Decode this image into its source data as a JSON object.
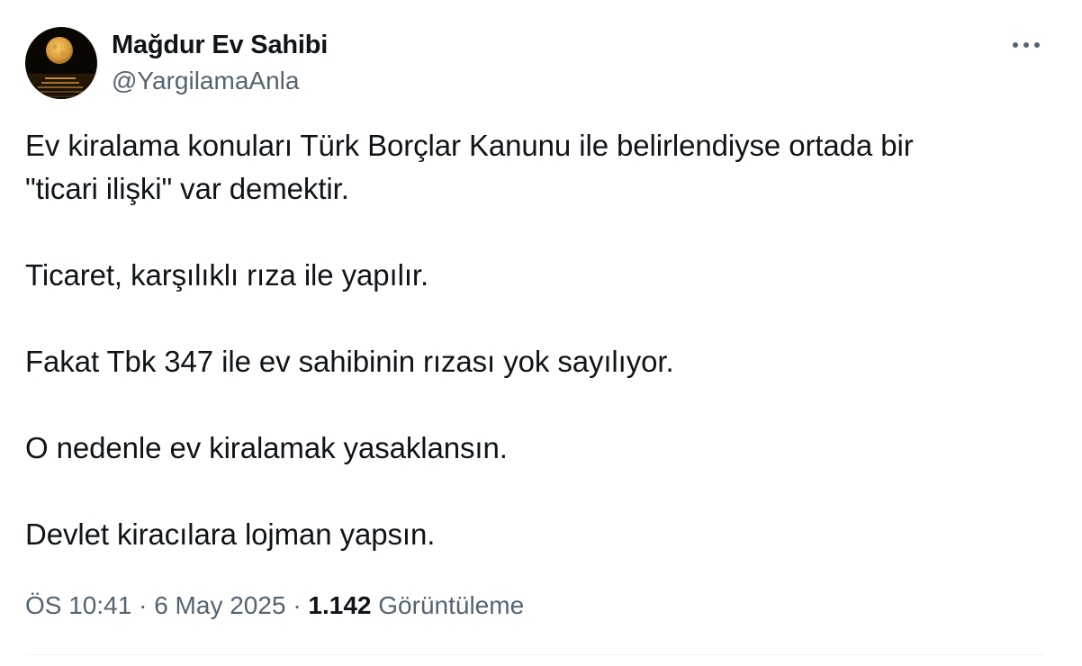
{
  "author": {
    "display_name": "Mağdur Ev Sahibi",
    "handle": "@YargilamaAnla",
    "avatar_icon": "full-moon-over-sea-avatar"
  },
  "more_icon": "more-horizontal-icon",
  "tweet": {
    "paragraphs": [
      {
        "lines": [
          "Ev kiralama konuları Türk Borçlar Kanunu ile belirlendiyse ortada bir",
          "\"ticari ilişki\" var demektir."
        ]
      },
      {
        "lines": [
          "Ticaret, karşılıklı rıza ile yapılır."
        ]
      },
      {
        "lines": [
          "Fakat Tbk 347 ile ev sahibinin rızası yok sayılıyor."
        ]
      },
      {
        "lines": [
          "O nedenle ev kiralamak yasaklansın."
        ]
      },
      {
        "lines": [
          "Devlet kiracılara lojman yapsın."
        ]
      }
    ]
  },
  "meta": {
    "time": "ÖS 10:41",
    "separator": "·",
    "date": "6 May 2025",
    "views_count": "1.142",
    "views_label": "Görüntüleme"
  },
  "colors": {
    "text_primary": "#0f1419",
    "text_secondary": "#536471",
    "divider": "#eff3f4"
  }
}
